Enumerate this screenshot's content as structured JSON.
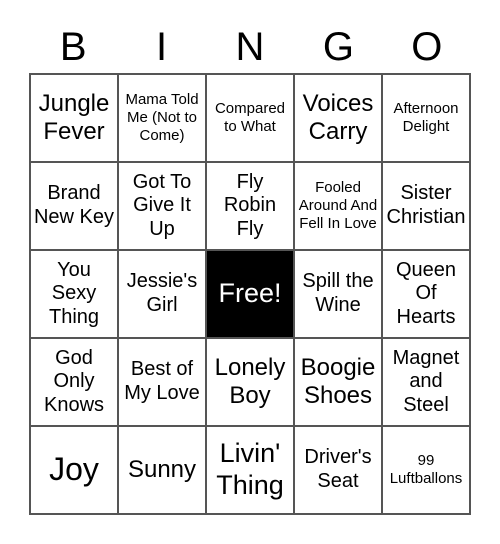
{
  "header": {
    "letters": [
      "B",
      "I",
      "N",
      "G",
      "O"
    ]
  },
  "cells": [
    "Jungle Fever",
    "Mama Told Me (Not to Come)",
    "Compared to What",
    "Voices Carry",
    "Afternoon Delight",
    "Brand New Key",
    "Got To Give It Up",
    "Fly Robin Fly",
    "Fooled Around And Fell In Love",
    "Sister Christian",
    "You Sexy Thing",
    "Jessie's Girl",
    "Free!",
    "Spill the Wine",
    "Queen Of Hearts",
    "God Only Knows",
    "Best of My Love",
    "Lonely Boy",
    "Boogie Shoes",
    "Magnet and Steel",
    "Joy",
    "Sunny",
    "Livin' Thing",
    "Driver's Seat",
    "99 Luftballons"
  ],
  "free_cell_index": 12,
  "colors": {
    "free_bg": "#000000",
    "free_text": "#ffffff",
    "grid_line": "#555555"
  }
}
